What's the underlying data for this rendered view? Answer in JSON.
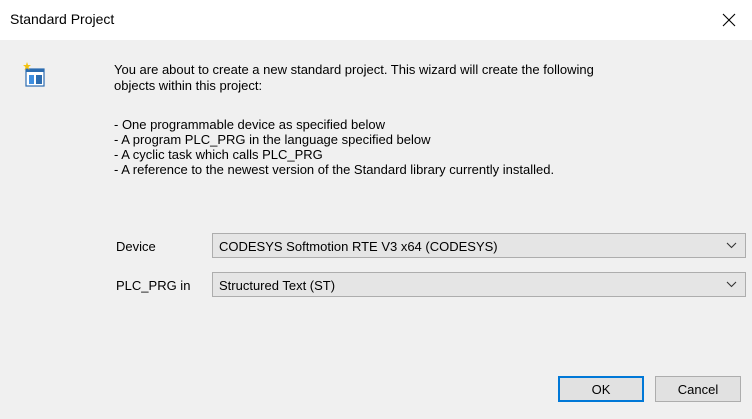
{
  "dialog": {
    "title": "Standard Project",
    "close_icon": "close-icon",
    "wizard_icon": "new-project-icon"
  },
  "intro": {
    "line1": "You are about to create a new standard project. This wizard will create the following",
    "line2": "objects within this project:"
  },
  "bullets": [
    "- One programmable device as specified below",
    "- A program PLC_PRG in the language specified below",
    "- A cyclic task which calls PLC_PRG",
    "- A reference to the newest version of the Standard library currently installed."
  ],
  "form": {
    "device_label": "Device",
    "device_value": "CODESYS Softmotion RTE V3 x64 (CODESYS)",
    "language_label": "PLC_PRG in",
    "language_value": "Structured Text (ST)"
  },
  "buttons": {
    "ok": "OK",
    "cancel": "Cancel"
  },
  "colors": {
    "accent": "#0078d7",
    "dialog_bg": "#f0f0f0"
  }
}
